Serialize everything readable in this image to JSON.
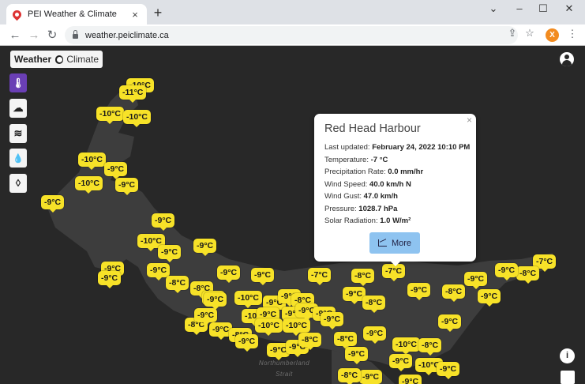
{
  "browser": {
    "tab_title": "PEI Weather & Climate",
    "tab_close": "×",
    "new_tab": "+",
    "minimize": "⌄",
    "minimize2": "–",
    "maximize": "☐",
    "close": "✕",
    "back": "←",
    "forward": "→",
    "reload": "↻",
    "url": "weather.peiclimate.ca",
    "share": "⇪",
    "star": "☆",
    "profile_initial": "X",
    "menu": "⋮"
  },
  "toggle": {
    "left": "Weather",
    "right": "Climate"
  },
  "layers": [
    {
      "icon": "thermometer-icon",
      "glyph": "🌡",
      "active": true
    },
    {
      "icon": "rain-cloud-icon",
      "glyph": "☁",
      "active": false
    },
    {
      "icon": "wind-icon",
      "glyph": "≋",
      "active": false
    },
    {
      "icon": "humidity-drop-icon",
      "glyph": "💧",
      "active": false
    },
    {
      "icon": "dewpoint-drop-icon",
      "glyph": "◊",
      "active": false
    }
  ],
  "map": {
    "water_label": [
      "Northumberland",
      "Strait"
    ],
    "markers": [
      {
        "t": "-10°C"
      },
      {
        "t": "-11°C"
      },
      {
        "t": "-10°C"
      },
      {
        "t": "-10°C"
      },
      {
        "t": "-10°C"
      },
      {
        "t": "-9°C"
      },
      {
        "t": "-10°C"
      },
      {
        "t": "-9°C"
      },
      {
        "t": "-9°C"
      },
      {
        "t": "-9°C"
      },
      {
        "t": "-10°C"
      },
      {
        "t": "-9°C"
      },
      {
        "t": "-9°C"
      },
      {
        "t": "-9°C"
      },
      {
        "t": "-9°C"
      },
      {
        "t": "-9°C"
      },
      {
        "t": "-8°C"
      },
      {
        "t": "-8°C"
      },
      {
        "t": "-9°C"
      },
      {
        "t": "-9°C"
      },
      {
        "t": "-9°C"
      },
      {
        "t": "-7°C"
      },
      {
        "t": "-8°C"
      },
      {
        "t": "-7°C"
      },
      {
        "t": "-9°C"
      },
      {
        "t": "-8°C"
      },
      {
        "t": "-7°C"
      },
      {
        "t": "-9°C"
      },
      {
        "t": "-8°C"
      },
      {
        "t": "-9°C"
      },
      {
        "t": "-9°C"
      },
      {
        "t": "-8°C"
      },
      {
        "t": "-10°C"
      },
      {
        "t": "-9°C"
      },
      {
        "t": "-9°C"
      },
      {
        "t": "-8°C"
      },
      {
        "t": "-8°C"
      },
      {
        "t": "-9°C"
      },
      {
        "t": "-9°C"
      },
      {
        "t": "-10°C"
      },
      {
        "t": "-9°C"
      },
      {
        "t": "-9°C"
      },
      {
        "t": "-8°C"
      },
      {
        "t": "-9°C"
      },
      {
        "t": "-10°C"
      },
      {
        "t": "-9°C"
      },
      {
        "t": "-10°C"
      },
      {
        "t": "-9°C"
      },
      {
        "t": "-9°C"
      },
      {
        "t": "-9°C"
      },
      {
        "t": "-8°C"
      },
      {
        "t": "-9°C"
      },
      {
        "t": "-9°C"
      },
      {
        "t": "-8°C"
      },
      {
        "t": "-9°C"
      },
      {
        "t": "-9°C"
      },
      {
        "t": "-10°C"
      },
      {
        "t": "-8°C"
      },
      {
        "t": "-9°C"
      },
      {
        "t": "-10°C"
      },
      {
        "t": "-9°C"
      },
      {
        "t": "-9°C"
      },
      {
        "t": "-9°C"
      },
      {
        "t": "-8°C"
      },
      {
        "t": "-9°C"
      },
      {
        "t": "-9°C"
      }
    ]
  },
  "popup": {
    "close": "×",
    "title": "Red Head Harbour",
    "rows": [
      {
        "label": "Last updated: ",
        "value": "February 24, 2022 10:10 PM"
      },
      {
        "label": "Temperature: ",
        "value": "-7 °C"
      },
      {
        "label": "Precipitation Rate: ",
        "value": "0.0 mm/hr"
      },
      {
        "label": "Wind Speed: ",
        "value": "40.0 km/h N"
      },
      {
        "label": "Wind Gust: ",
        "value": "47.0 km/h"
      },
      {
        "label": "Pressure: ",
        "value": "1028.7 hPa"
      },
      {
        "label": "Solar Radiation: ",
        "value": "1.0 W/m²"
      }
    ],
    "more_label": "More"
  },
  "controls": {
    "info": "i"
  }
}
